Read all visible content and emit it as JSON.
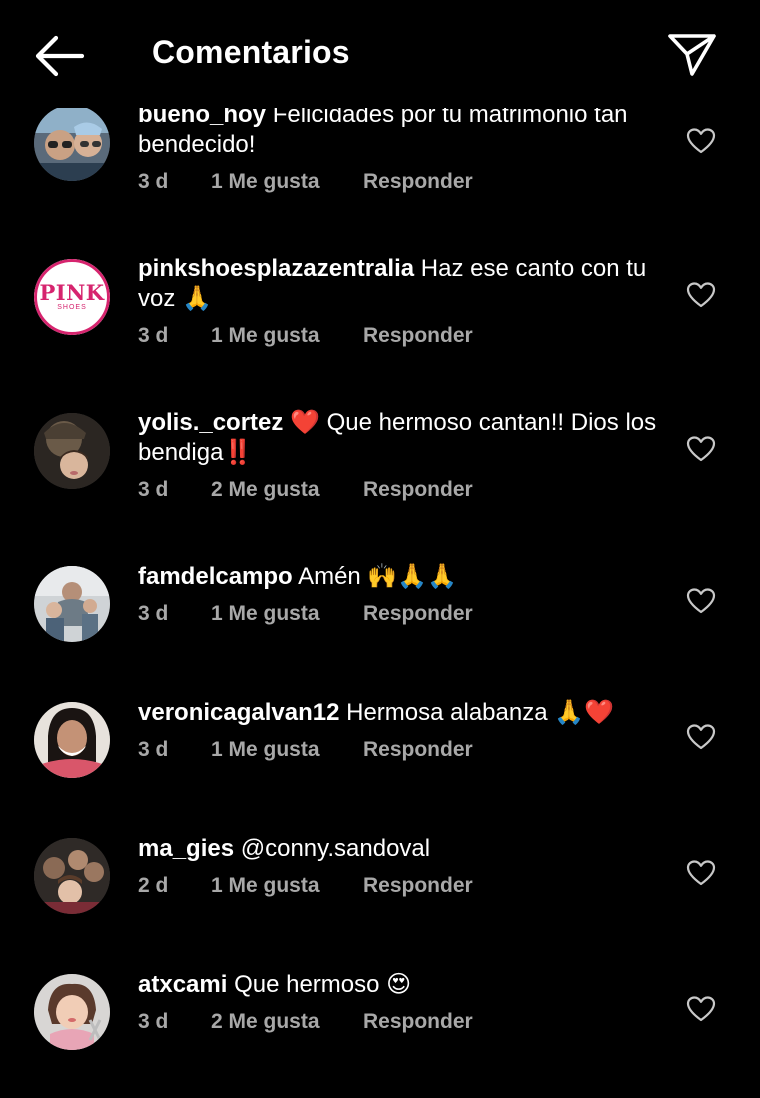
{
  "header": {
    "title": "Comentarios",
    "back_icon": "arrow-left-icon",
    "send_icon": "paper-plane-icon"
  },
  "comments": [
    {
      "username": "bueno_hoy",
      "text": "Felicidades por tu matrimonio tan bendecido!",
      "time": "3 d",
      "likes": "1 Me gusta",
      "reply": "Responder"
    },
    {
      "username": "pinkshoesplazazentralia",
      "text": "Haz ese canto con tu voz 🙏",
      "time": "3 d",
      "likes": "1 Me gusta",
      "reply": "Responder",
      "avatar_logo": "PINK",
      "avatar_logo_sub": "SHOES"
    },
    {
      "username": "yolis._cortez",
      "text": "❤️ Que hermoso cantan!! Dios los bendiga‼️",
      "time": "3 d",
      "likes": "2 Me gusta",
      "reply": "Responder"
    },
    {
      "username": "famdelcampo",
      "text": "Amén 🙌🙏🙏",
      "time": "3 d",
      "likes": "1 Me gusta",
      "reply": "Responder"
    },
    {
      "username": "veronicagalvan12",
      "text": "Hermosa alabanza 🙏❤️",
      "time": "3 d",
      "likes": "1 Me gusta",
      "reply": "Responder"
    },
    {
      "username": "ma_gies",
      "text": "@conny.sandoval",
      "time": "2 d",
      "likes": "1 Me gusta",
      "reply": "Responder"
    },
    {
      "username": "atxcami",
      "text": "Que hermoso 😍",
      "time": "3 d",
      "likes": "2 Me gusta",
      "reply": "Responder"
    }
  ],
  "colors": {
    "background": "#000000",
    "text": "#ffffff",
    "meta": "#a8a8a8",
    "pink_brand": "#d6246e"
  }
}
